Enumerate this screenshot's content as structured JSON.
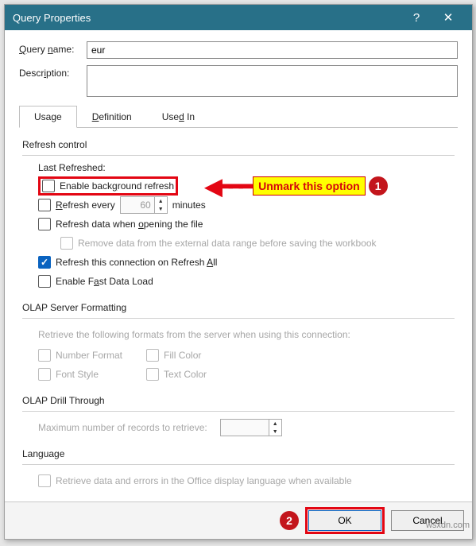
{
  "titlebar": {
    "title": "Query Properties",
    "help": "?",
    "close": "✕"
  },
  "fields": {
    "query_name_label": "Query name:",
    "query_name_value": "eur",
    "description_label": "Description:",
    "description_value": ""
  },
  "tabs": {
    "usage": "Usage",
    "definition": "Definition",
    "used_in": "Used In"
  },
  "refresh": {
    "section": "Refresh control",
    "last_refreshed": "Last Refreshed:",
    "enable_bg": "Enable background refresh",
    "refresh_every_pre": "Refresh every",
    "refresh_every_val": "60",
    "refresh_every_post": "minutes",
    "on_open": "Refresh data when opening the file",
    "remove_data": "Remove data from the external data range before saving the workbook",
    "refresh_all": "Refresh this connection on Refresh All",
    "fast_load": "Enable Fast Data Load"
  },
  "olap_fmt": {
    "section": "OLAP Server Formatting",
    "desc": "Retrieve the following formats from the server when using this connection:",
    "number_format": "Number Format",
    "fill_color": "Fill Color",
    "font_style": "Font Style",
    "text_color": "Text Color"
  },
  "olap_drill": {
    "section": "OLAP Drill Through",
    "label": "Maximum number of records to retrieve:",
    "value": ""
  },
  "language": {
    "section": "Language",
    "opt": "Retrieve data and errors in the Office display language when available"
  },
  "footer": {
    "ok": "OK",
    "cancel": "Cancel"
  },
  "annot": {
    "label": "Unmark this option",
    "num1": "1",
    "num2": "2"
  },
  "watermark": "wsxdn.com"
}
